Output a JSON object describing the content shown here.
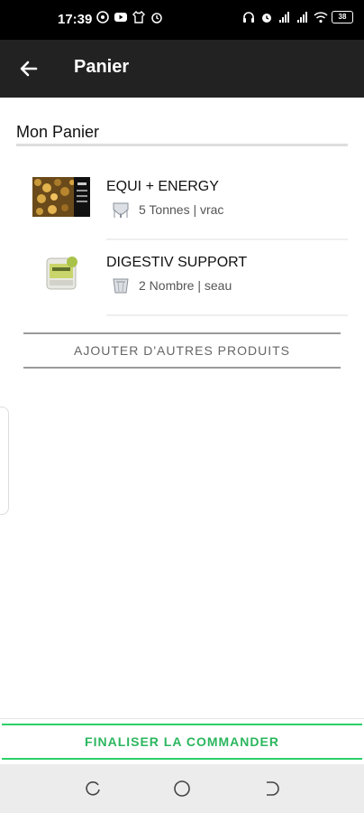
{
  "status_bar": {
    "time": "17:39",
    "battery": "38",
    "left_icons": [
      "whatsapp-icon",
      "youtube-icon",
      "tshirt-icon",
      "alarm-icon"
    ],
    "right_icons": [
      "headphones-icon",
      "alarm-icon",
      "signal-icon",
      "signal-icon",
      "wifi-icon",
      "battery-icon"
    ]
  },
  "app_bar": {
    "title": "Panier",
    "back_icon": "arrow-left-icon"
  },
  "cart": {
    "title": "Mon Panier",
    "items": [
      {
        "name": "EQUI + ENERGY",
        "meta": "5 Tonnes | vrac",
        "meta_icon": "silo-icon"
      },
      {
        "name": "DIGESTIV SUPPORT",
        "meta": "2 Nombre | seau",
        "meta_icon": "bucket-icon"
      }
    ],
    "add_more_label": "AJOUTER D'AUTRES PRODUITS"
  },
  "footer": {
    "finalize_label": "FINALISER LA COMMANDER"
  },
  "colors": {
    "appbar": "#222222",
    "accent_green": "#2bb65e",
    "status": "#000000"
  }
}
